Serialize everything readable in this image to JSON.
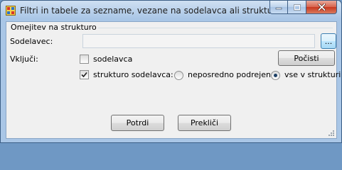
{
  "window": {
    "title": "Filtri in tabele za sezname, vezane na sodelavca ali strukturo",
    "caption_buttons": [
      "minimize-icon",
      "maximize-icon",
      "close-icon"
    ]
  },
  "group": {
    "label": "Omejitev na strukturo"
  },
  "sodelavec": {
    "label": "Sodelavec:",
    "value": "",
    "browse_label": "..."
  },
  "vkljuci": {
    "label": "Vključi:",
    "checkbox_sodelavca": {
      "label": "sodelavca",
      "checked": false
    },
    "checkbox_struktura": {
      "label": "strukturo sodelavca:",
      "checked": true
    },
    "radio_neposredno": {
      "label": "neposredno podrejene",
      "selected": false
    },
    "radio_vse": {
      "label": "vse v strukturi",
      "selected": true
    }
  },
  "buttons": {
    "clear": "Počisti",
    "confirm": "Potrdi",
    "cancel": "Prekliči"
  }
}
